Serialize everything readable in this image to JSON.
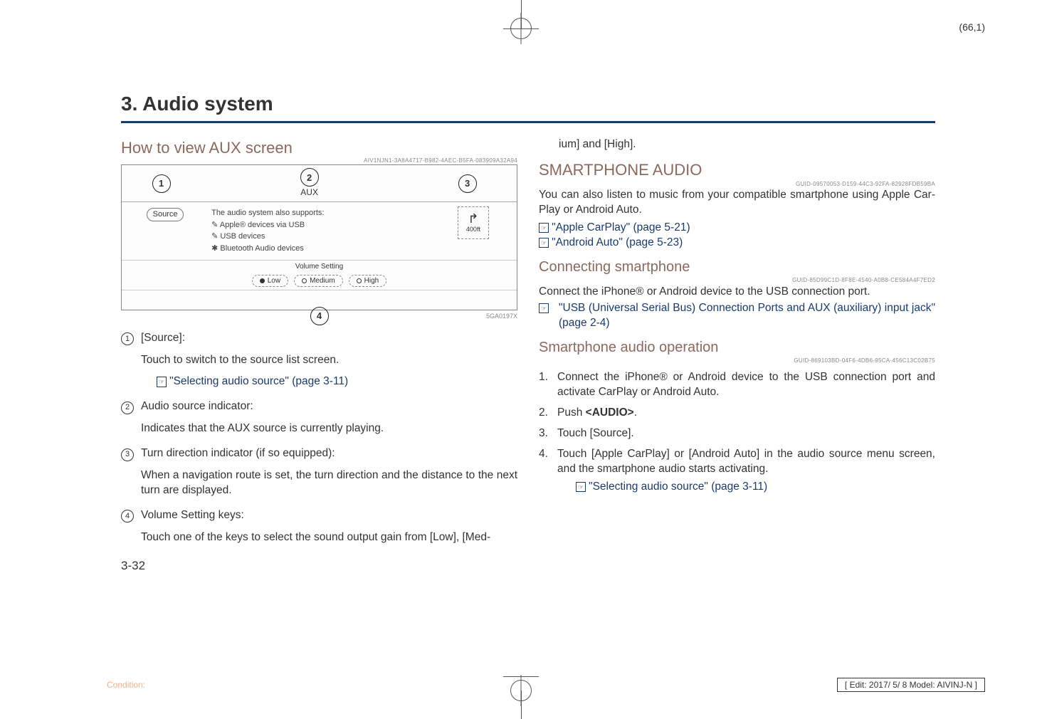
{
  "page_num_top": "(66,1)",
  "chapter": "3. Audio system",
  "howto": {
    "title": "How to view AUX screen",
    "guid": "AIV1NJN1-3A8A4717-B982-4AEC-B5FA-083909A32A94"
  },
  "aux_image": {
    "header": "AUX",
    "source_btn": "Source",
    "lines": [
      "The audio system also supports:",
      "Apple® devices via USB",
      "USB devices",
      "Bluetooth Audio devices"
    ],
    "turn_distance": "400ft",
    "volume_label": "Volume Setting",
    "vol_low": "Low",
    "vol_med": "Medium",
    "vol_high": "High",
    "image_id": "5GA0197X"
  },
  "items": [
    {
      "marker": "1",
      "title": "[Source]:",
      "body": "Touch to switch to the source list screen.",
      "link": "\"Selecting audio source\" (page 3-11)"
    },
    {
      "marker": "2",
      "title": "Audio source indicator:",
      "body": "Indicates that the AUX source is currently playing."
    },
    {
      "marker": "3",
      "title": "Turn direction indicator (if so equipped):",
      "body": "When a navigation route is set, the turn direction and the distance to the next turn are displayed."
    },
    {
      "marker": "4",
      "title": "Volume Setting keys:",
      "body": "Touch one of the keys to select the sound output gain from [Low], [Med-"
    }
  ],
  "col2_carry": "ium] and [High].",
  "smartphone_audio": {
    "title": "SMARTPHONE AUDIO",
    "guid": "GUID-09570053-D159-44C3-92FA-82928FDB59BA",
    "body": "You can also listen to music from your compatible smartphone using Apple Car-Play or Android Auto.",
    "link1": "\"Apple CarPlay\" (page 5-21)",
    "link2": "\"Android Auto\" (page 5-23)"
  },
  "connecting": {
    "title": "Connecting smartphone",
    "guid": "GUID-85D99C1D-8F8E-4540-A0B8-CE584A4F7ED2",
    "body": "Connect the iPhone® or Android device to the USB connection port.",
    "link": "\"USB (Universal Serial Bus) Connection Ports and AUX (auxiliary) input jack\" (page 2-4)"
  },
  "operation": {
    "title": "Smartphone audio operation",
    "guid": "GUID-869103BD-04F6-4DB6-95CA-456C13C02B75",
    "steps": [
      "Connect the iPhone® or Android device to the USB connection port and activate CarPlay or Android Auto.",
      "Push <AUDIO>.",
      "Touch [Source].",
      "Touch [Apple CarPlay] or [Android Auto] in the audio source menu screen, and the smartphone audio starts activating."
    ],
    "link": "\"Selecting audio source\" (page 3-11)"
  },
  "page_num_bottom": "3-32",
  "footer": {
    "condition": "Condition:",
    "edit": "[ Edit: 2017/ 5/ 8   Model:  AIVINJ-N ]"
  }
}
